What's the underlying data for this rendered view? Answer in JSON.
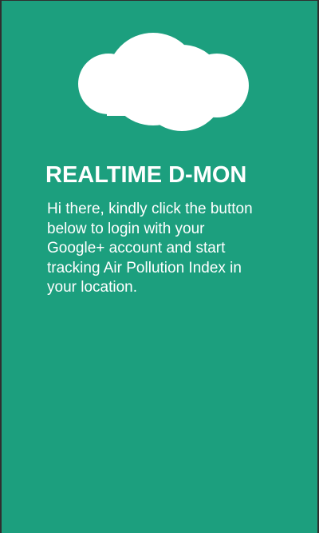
{
  "colors": {
    "background": "#1c9f7e",
    "foreground": "#ffffff",
    "frame": "#2f2f2f"
  },
  "logo": {
    "icon": "cloud-icon"
  },
  "title": "REALTIME D-MON",
  "intro": "Hi there, kindly click the button below to login with your Google+ account and start tracking Air Pollution Index in your location."
}
